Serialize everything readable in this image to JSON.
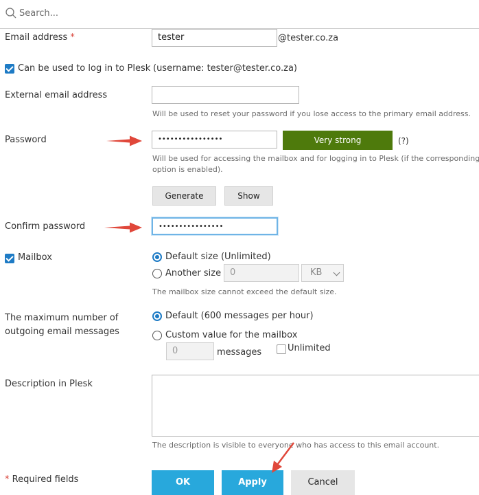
{
  "search": {
    "placeholder": "Search..."
  },
  "email": {
    "label": "Email address",
    "required_mark": "*",
    "value": "tester",
    "domain": "@tester.co.za"
  },
  "login": {
    "label": "Can be used to log in to Plesk",
    "username_note": "(username: tester@tester.co.za)",
    "checked": true
  },
  "external_email": {
    "label": "External email address",
    "value": "",
    "hint": "Will be used to reset your password if you lose access to the primary email address."
  },
  "password": {
    "label": "Password",
    "value": "••••••••••••••••",
    "strength": "Very strong",
    "help": "(?)",
    "hint_line1": "Will be used for accessing the mailbox and for logging in to Plesk (if the corresponding",
    "hint_line2": "option is enabled).",
    "generate_label": "Generate",
    "show_label": "Show"
  },
  "confirm_password": {
    "label": "Confirm password",
    "value": "••••••••••••••••"
  },
  "mailbox": {
    "label": "Mailbox",
    "checked": true,
    "default_label": "Default size (Unlimited)",
    "another_label": "Another size",
    "size_value": "0",
    "unit": "KB",
    "hint": "The mailbox size cannot exceed the default size."
  },
  "outgoing": {
    "label_line1": "The maximum number of",
    "label_line2": "outgoing email messages",
    "default_label": "Default (600 messages per hour)",
    "custom_label": "Custom value for the mailbox",
    "custom_value": "0",
    "messages_label": "messages",
    "unlimited_label": "Unlimited"
  },
  "description": {
    "label": "Description in Plesk",
    "value": "",
    "hint": "The description is visible to everyone who has access to this email account."
  },
  "footer": {
    "required_note": "Required fields",
    "required_mark": "*",
    "ok_label": "OK",
    "apply_label": "Apply",
    "cancel_label": "Cancel"
  },
  "colors": {
    "accent": "#28a8dc",
    "checkbox": "#1e7bc5",
    "strength": "#4e7a0c",
    "annotation_arrow": "#e0473a",
    "required": "#d9443a"
  }
}
